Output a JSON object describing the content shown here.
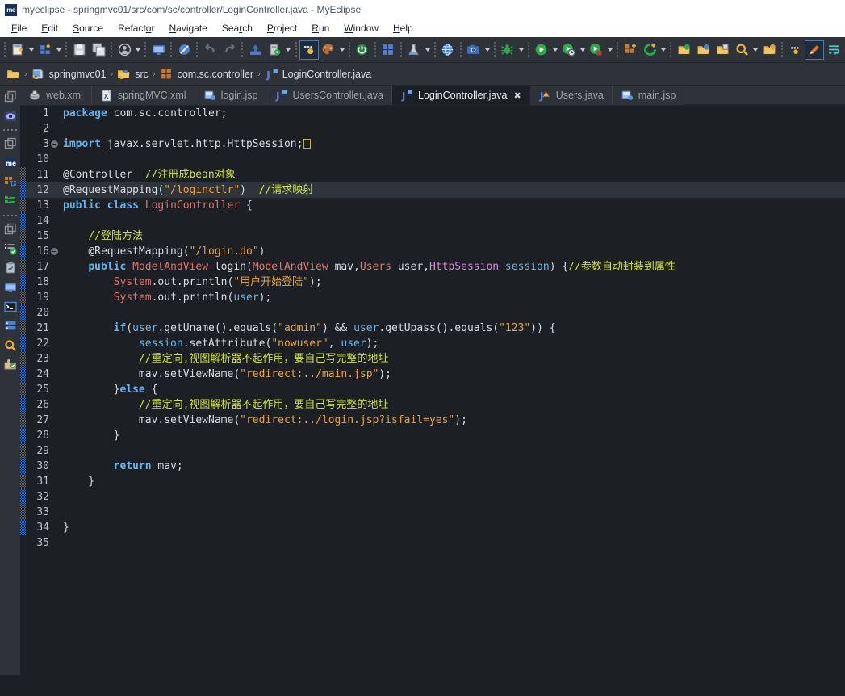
{
  "window": {
    "app_badge": "me",
    "title": "myeclipse - springmvc01/src/com/sc/controller/LoginController.java - MyEclipse"
  },
  "menubar": {
    "items": [
      {
        "label": "File",
        "mnemonic": "F"
      },
      {
        "label": "Edit",
        "mnemonic": "E"
      },
      {
        "label": "Source",
        "mnemonic": "S"
      },
      {
        "label": "Refactor",
        "mnemonic": "o"
      },
      {
        "label": "Navigate",
        "mnemonic": "N"
      },
      {
        "label": "Search",
        "mnemonic": "r"
      },
      {
        "label": "Project",
        "mnemonic": "P"
      },
      {
        "label": "Run",
        "mnemonic": "R"
      },
      {
        "label": "Window",
        "mnemonic": "W"
      },
      {
        "label": "Help",
        "mnemonic": "H"
      }
    ]
  },
  "toolbar": {
    "groups": [
      {
        "buttons": [
          {
            "icon": "new-file-icon",
            "caret": true
          },
          {
            "icon": "new-wizard-icon",
            "caret": true
          }
        ]
      },
      {
        "buttons": [
          {
            "icon": "save-icon",
            "caret": false
          },
          {
            "icon": "save-all-icon",
            "caret": false
          }
        ]
      },
      {
        "buttons": [
          {
            "icon": "user-icon",
            "caret": true
          }
        ]
      },
      {
        "buttons": [
          {
            "icon": "monitor-icon",
            "caret": false
          }
        ]
      },
      {
        "buttons": [
          {
            "icon": "no-entry-icon",
            "caret": false
          }
        ]
      },
      {
        "buttons": [
          {
            "icon": "undo-arrow-icon",
            "caret": false
          },
          {
            "icon": "redo-arrow-icon",
            "caret": false
          }
        ]
      },
      {
        "buttons": [
          {
            "icon": "deploy-icon",
            "caret": false
          },
          {
            "icon": "server-icon",
            "caret": true
          }
        ]
      },
      {
        "buttons": [
          {
            "icon": "perspective-icon",
            "caret": false,
            "selected": true
          },
          {
            "icon": "palette-icon",
            "caret": true
          }
        ]
      },
      {
        "buttons": [
          {
            "icon": "power-icon",
            "caret": false
          }
        ]
      },
      {
        "buttons": [
          {
            "icon": "layout-icon",
            "caret": false
          }
        ]
      },
      {
        "buttons": [
          {
            "icon": "flask-icon",
            "caret": true
          }
        ]
      },
      {
        "buttons": [
          {
            "icon": "globe-icon",
            "caret": false
          }
        ]
      },
      {
        "buttons": [
          {
            "icon": "camera-icon",
            "caret": true
          }
        ]
      },
      {
        "buttons": [
          {
            "icon": "debug-bug-icon",
            "caret": true
          }
        ]
      },
      {
        "buttons": [
          {
            "icon": "run-icon",
            "caret": true
          },
          {
            "icon": "run-history-icon",
            "caret": true
          },
          {
            "icon": "run-stop-icon",
            "caret": true
          }
        ]
      },
      {
        "buttons": [
          {
            "icon": "new-package-icon",
            "caret": false
          },
          {
            "icon": "new-class-icon",
            "caret": true
          }
        ]
      },
      {
        "buttons": [
          {
            "icon": "open-type-icon",
            "caret": false
          },
          {
            "icon": "open-resource-icon",
            "caret": false
          },
          {
            "icon": "open-task-icon",
            "caret": false
          },
          {
            "icon": "search-icon",
            "caret": true
          },
          {
            "icon": "open-other-icon",
            "caret": false
          }
        ]
      },
      {
        "buttons": [
          {
            "icon": "more-icon",
            "caret": false
          },
          {
            "icon": "pencil-icon",
            "caret": false,
            "selected": true
          },
          {
            "icon": "word-wrap-icon",
            "caret": false
          }
        ]
      }
    ]
  },
  "breadcrumb": {
    "items": [
      {
        "label": "",
        "icon": "folder-open-icon"
      },
      {
        "label": "springmvc01",
        "icon": "project-icon"
      },
      {
        "label": "src",
        "icon": "source-folder-icon"
      },
      {
        "label": "com.sc.controller",
        "icon": "package-icon"
      },
      {
        "label": "LoginController.java",
        "icon": "java-file-icon"
      }
    ],
    "separator": "›"
  },
  "rail": {
    "items": [
      {
        "icon": "restore-icon",
        "name": "restore-view"
      },
      {
        "icon": "eye-icon",
        "name": "outline-view"
      },
      {
        "icon": "separator",
        "name": "rail-separator-1"
      },
      {
        "icon": "restore-icon",
        "name": "restore-view-2"
      },
      {
        "icon": "me-icon",
        "name": "myeclipse-view"
      },
      {
        "icon": "package-explorer-icon",
        "name": "package-explorer-view"
      },
      {
        "icon": "hierarchy-icon",
        "name": "type-hierarchy-view"
      },
      {
        "icon": "separator",
        "name": "rail-separator-2"
      },
      {
        "icon": "restore-icon",
        "name": "restore-view-3"
      },
      {
        "icon": "tasks-icon",
        "name": "tasks-view"
      },
      {
        "icon": "clipboard-icon",
        "name": "problems-view"
      },
      {
        "icon": "monitor-icon",
        "name": "servers-view"
      },
      {
        "icon": "console-icon",
        "name": "console-view"
      },
      {
        "icon": "database-icon",
        "name": "db-browser-view"
      },
      {
        "icon": "search-icon",
        "name": "search-view"
      },
      {
        "icon": "snippets-icon",
        "name": "snippets-view"
      }
    ]
  },
  "tabs": [
    {
      "label": "web.xml",
      "icon": "xml-file-icon",
      "active": false,
      "closable": false
    },
    {
      "label": "springMVC.xml",
      "icon": "xml-config-icon",
      "active": false,
      "closable": false
    },
    {
      "label": "login.jsp",
      "icon": "jsp-file-icon",
      "active": false,
      "closable": false
    },
    {
      "label": "UsersController.java",
      "icon": "java-file-icon",
      "active": false,
      "closable": false
    },
    {
      "label": "LoginController.java",
      "icon": "java-file-icon",
      "active": true,
      "closable": true,
      "close_glyph": "✖"
    },
    {
      "label": "Users.java",
      "icon": "java-warning-icon",
      "active": false,
      "closable": false
    },
    {
      "label": "main.jsp",
      "icon": "jsp-file-icon",
      "active": false,
      "closable": false
    }
  ],
  "editor": {
    "lines": [
      {
        "num": "1",
        "changed": false,
        "current": false,
        "fold": "none",
        "tokens": [
          {
            "t": "package ",
            "c": "kw"
          },
          {
            "t": "com.sc.controller;",
            "c": "plain"
          }
        ]
      },
      {
        "num": "2",
        "changed": false,
        "current": false,
        "fold": "none",
        "tokens": []
      },
      {
        "num": "3",
        "changed": false,
        "current": false,
        "fold": "collapsed",
        "tokens": [
          {
            "t": "import ",
            "c": "kw"
          },
          {
            "t": "javax.servlet.http.HttpSession;",
            "c": "plain"
          },
          {
            "t": "□",
            "c": "collapsed"
          }
        ]
      },
      {
        "num": "10",
        "changed": false,
        "current": false,
        "fold": "none",
        "tokens": []
      },
      {
        "num": "11",
        "changed": true,
        "current": false,
        "fold": "none",
        "tokens": [
          {
            "t": "@Controller",
            "c": "ann"
          },
          {
            "t": "  ",
            "c": "plain"
          },
          {
            "t": "//注册成bean对象",
            "c": "cmt"
          }
        ]
      },
      {
        "num": "12",
        "changed": true,
        "current": true,
        "fold": "none",
        "tokens": [
          {
            "t": "@RequestMapping(",
            "c": "ann"
          },
          {
            "t": "\"/loginctlr\"",
            "c": "str"
          },
          {
            "t": ")",
            "c": "ann"
          },
          {
            "t": "  ",
            "c": "plain"
          },
          {
            "t": "//请求映射",
            "c": "cmt"
          }
        ]
      },
      {
        "num": "13",
        "changed": true,
        "current": false,
        "fold": "none",
        "tokens": [
          {
            "t": "public ",
            "c": "kw"
          },
          {
            "t": "class ",
            "c": "kw"
          },
          {
            "t": "LoginController",
            "c": "typ"
          },
          {
            "t": " {",
            "c": "plain"
          }
        ]
      },
      {
        "num": "14",
        "changed": true,
        "current": false,
        "fold": "none",
        "tokens": []
      },
      {
        "num": "15",
        "changed": true,
        "current": false,
        "fold": "none",
        "tokens": [
          {
            "t": "    ",
            "c": "plain"
          },
          {
            "t": "//登陆方法",
            "c": "cmt"
          }
        ]
      },
      {
        "num": "16",
        "changed": true,
        "current": false,
        "fold": "expanded",
        "tokens": [
          {
            "t": "    ",
            "c": "plain"
          },
          {
            "t": "@RequestMapping(",
            "c": "ann"
          },
          {
            "t": "\"/login.do\"",
            "c": "str"
          },
          {
            "t": ")",
            "c": "ann"
          }
        ]
      },
      {
        "num": "17",
        "changed": true,
        "current": false,
        "fold": "none",
        "tokens": [
          {
            "t": "    ",
            "c": "plain"
          },
          {
            "t": "public ",
            "c": "kw"
          },
          {
            "t": "ModelAndView",
            "c": "typ"
          },
          {
            "t": " login(",
            "c": "plain"
          },
          {
            "t": "ModelAndView",
            "c": "typ"
          },
          {
            "t": " mav,",
            "c": "plain"
          },
          {
            "t": "Users",
            "c": "typ"
          },
          {
            "t": " user,",
            "c": "plain"
          },
          {
            "t": "HttpSession",
            "c": "typ2"
          },
          {
            "t": " session",
            "c": "fld"
          },
          {
            "t": ") {",
            "c": "plain"
          },
          {
            "t": "//参数自动封装到属性",
            "c": "cmt"
          }
        ]
      },
      {
        "num": "18",
        "changed": true,
        "current": false,
        "fold": "none",
        "tokens": [
          {
            "t": "        ",
            "c": "plain"
          },
          {
            "t": "System",
            "c": "typ"
          },
          {
            "t": ".out.println(",
            "c": "plain"
          },
          {
            "t": "\"用户开始登陆\"",
            "c": "str"
          },
          {
            "t": ");",
            "c": "plain"
          }
        ]
      },
      {
        "num": "19",
        "changed": true,
        "current": false,
        "fold": "none",
        "tokens": [
          {
            "t": "        ",
            "c": "plain"
          },
          {
            "t": "System",
            "c": "typ"
          },
          {
            "t": ".out.println(",
            "c": "plain"
          },
          {
            "t": "user",
            "c": "fld"
          },
          {
            "t": ");",
            "c": "plain"
          }
        ]
      },
      {
        "num": "20",
        "changed": true,
        "current": false,
        "fold": "none",
        "tokens": []
      },
      {
        "num": "21",
        "changed": true,
        "current": false,
        "fold": "none",
        "tokens": [
          {
            "t": "        ",
            "c": "plain"
          },
          {
            "t": "if",
            "c": "kw"
          },
          {
            "t": "(",
            "c": "plain"
          },
          {
            "t": "user",
            "c": "fld"
          },
          {
            "t": ".getUname().equals(",
            "c": "plain"
          },
          {
            "t": "\"admin\"",
            "c": "str"
          },
          {
            "t": ") && ",
            "c": "plain"
          },
          {
            "t": "user",
            "c": "fld"
          },
          {
            "t": ".getUpass().equals(",
            "c": "plain"
          },
          {
            "t": "\"123\"",
            "c": "str"
          },
          {
            "t": ")) {",
            "c": "plain"
          }
        ]
      },
      {
        "num": "22",
        "changed": true,
        "current": false,
        "fold": "none",
        "tokens": [
          {
            "t": "            ",
            "c": "plain"
          },
          {
            "t": "session",
            "c": "fld"
          },
          {
            "t": ".setAttribute(",
            "c": "plain"
          },
          {
            "t": "\"nowuser\"",
            "c": "str"
          },
          {
            "t": ", ",
            "c": "plain"
          },
          {
            "t": "user",
            "c": "fld"
          },
          {
            "t": ");",
            "c": "plain"
          }
        ]
      },
      {
        "num": "23",
        "changed": true,
        "current": false,
        "fold": "none",
        "tokens": [
          {
            "t": "            ",
            "c": "plain"
          },
          {
            "t": "//重定向,视图解析器不起作用，要自己写完整的地址",
            "c": "cmt"
          }
        ]
      },
      {
        "num": "24",
        "changed": true,
        "current": false,
        "fold": "none",
        "tokens": [
          {
            "t": "            mav.setViewName(",
            "c": "plain"
          },
          {
            "t": "\"redirect:../main.jsp\"",
            "c": "str"
          },
          {
            "t": ");",
            "c": "plain"
          }
        ]
      },
      {
        "num": "25",
        "changed": true,
        "current": false,
        "fold": "none",
        "tokens": [
          {
            "t": "        }",
            "c": "plain"
          },
          {
            "t": "else",
            "c": "kw"
          },
          {
            "t": " {",
            "c": "plain"
          }
        ]
      },
      {
        "num": "26",
        "changed": true,
        "current": false,
        "fold": "none",
        "tokens": [
          {
            "t": "            ",
            "c": "plain"
          },
          {
            "t": "//重定向,视图解析器不起作用，要自己写完整的地址",
            "c": "cmt"
          }
        ]
      },
      {
        "num": "27",
        "changed": true,
        "current": false,
        "fold": "none",
        "tokens": [
          {
            "t": "            mav.setViewName(",
            "c": "plain"
          },
          {
            "t": "\"redirect:../login.jsp?isfail=yes\"",
            "c": "str"
          },
          {
            "t": ");",
            "c": "plain"
          }
        ]
      },
      {
        "num": "28",
        "changed": true,
        "current": false,
        "fold": "none",
        "tokens": [
          {
            "t": "        }",
            "c": "plain"
          }
        ]
      },
      {
        "num": "29",
        "changed": true,
        "current": false,
        "fold": "none",
        "tokens": []
      },
      {
        "num": "30",
        "changed": true,
        "current": false,
        "fold": "none",
        "tokens": [
          {
            "t": "        ",
            "c": "plain"
          },
          {
            "t": "return",
            "c": "kw"
          },
          {
            "t": " mav;",
            "c": "plain"
          }
        ]
      },
      {
        "num": "31",
        "changed": true,
        "current": false,
        "fold": "none",
        "tokens": [
          {
            "t": "    }",
            "c": "plain"
          }
        ]
      },
      {
        "num": "32",
        "changed": true,
        "current": false,
        "fold": "none",
        "tokens": []
      },
      {
        "num": "33",
        "changed": true,
        "current": false,
        "fold": "none",
        "tokens": []
      },
      {
        "num": "34",
        "changed": true,
        "current": false,
        "fold": "none",
        "tokens": [
          {
            "t": "}",
            "c": "plain"
          }
        ]
      },
      {
        "num": "35",
        "changed": false,
        "current": false,
        "fold": "none",
        "tokens": []
      }
    ]
  },
  "colors": {
    "editor_bg": "#1c2024",
    "chrome_bg": "#2e333a",
    "current_line": "#2e343c",
    "accent_blue": "#2f6fc4",
    "string": "#e8a33d",
    "comment": "#cfe03a",
    "keyword": "#64b3ef",
    "type": "#e0736c"
  }
}
